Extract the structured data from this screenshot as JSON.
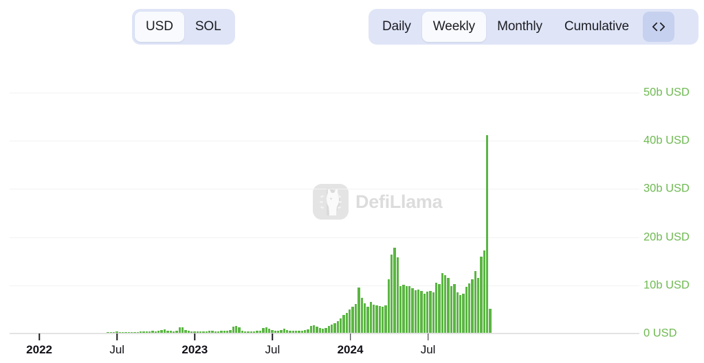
{
  "toolbar": {
    "currency_toggle": {
      "name": "currency-toggle",
      "options": [
        "USD",
        "SOL"
      ],
      "selected": "USD"
    },
    "period_toggle": {
      "name": "period-toggle",
      "options": [
        "Daily",
        "Weekly",
        "Monthly",
        "Cumulative"
      ],
      "selected": "Weekly",
      "code_button_label": "<>",
      "code_button_icon": "code-icon"
    },
    "colors": {
      "group_bg": "#dfe5f7",
      "active_pill_bg": "#f8fafd",
      "code_btn_bg": "#c6d1ef",
      "text": "#1c1c22"
    }
  },
  "watermark": {
    "text": "DefiLlama",
    "logo_icon": "defillama-llama-icon",
    "color": "#dcdcdc"
  },
  "chart_data": {
    "type": "bar",
    "title": "",
    "subtitle": "",
    "xlabel": "",
    "ylabel": "",
    "unit": "USD",
    "bar_color": "#5bb543",
    "axis_label_color": "#6fba52",
    "grid": true,
    "legend": null,
    "ylim": [
      0,
      52
    ],
    "yticks": [
      0,
      10,
      20,
      30,
      40,
      50
    ],
    "ytick_labels": [
      "0 USD",
      "10b USD",
      "20b USD",
      "30b USD",
      "40b USD",
      "50b USD"
    ],
    "xtick_labels": [
      "2022",
      "Jul",
      "2023",
      "Jul",
      "2024",
      "Jul"
    ],
    "xtick_indices": [
      4,
      30,
      56,
      82,
      108,
      134
    ],
    "x_label_bold": [
      true,
      false,
      true,
      false,
      true,
      false
    ],
    "values": [
      0.02,
      0.03,
      0.03,
      0.04,
      0.05,
      0.05,
      0.06,
      0.05,
      0.06,
      0.07,
      0.08,
      0.08,
      0.09,
      0.1,
      0.1,
      0.09,
      0.11,
      0.12,
      0.12,
      0.13,
      0.14,
      0.15,
      0.15,
      0.16,
      0.18,
      0.18,
      0.2,
      0.22,
      0.24,
      0.26,
      0.38,
      0.3,
      0.28,
      0.28,
      0.3,
      0.32,
      0.34,
      0.33,
      0.36,
      0.38,
      0.4,
      0.45,
      0.52,
      0.48,
      0.55,
      0.68,
      0.8,
      0.62,
      0.55,
      0.48,
      0.58,
      1.3,
      1.35,
      0.7,
      0.55,
      0.45,
      0.4,
      0.42,
      0.45,
      0.48,
      0.5,
      0.52,
      0.54,
      0.5,
      0.48,
      0.52,
      0.58,
      0.62,
      0.75,
      1.4,
      1.55,
      1.3,
      0.55,
      0.48,
      0.45,
      0.42,
      0.5,
      0.55,
      0.6,
      1.2,
      1.3,
      0.95,
      0.7,
      0.62,
      0.58,
      0.75,
      1.0,
      0.7,
      0.6,
      0.55,
      0.52,
      0.58,
      0.62,
      0.7,
      0.85,
      1.6,
      1.7,
      1.45,
      1.2,
      0.95,
      1.1,
      1.55,
      1.8,
      2.1,
      2.6,
      3.2,
      3.8,
      4.3,
      5.0,
      5.5,
      6.1,
      9.6,
      7.4,
      6.2,
      5.6,
      6.6,
      6.0,
      5.8,
      5.7,
      5.6,
      5.9,
      11.2,
      16.4,
      17.8,
      15.8,
      9.9,
      10.1,
      9.9,
      9.8,
      9.4,
      9.0,
      9.1,
      8.8,
      8.3,
      8.7,
      8.9,
      8.6,
      10.6,
      10.2,
      12.6,
      12.1,
      11.6,
      9.8,
      10.2,
      8.6,
      8.0,
      8.2,
      9.7,
      10.4,
      11.3,
      13.0,
      11.6,
      16.0,
      17.2,
      41.2,
      5.2
    ]
  }
}
